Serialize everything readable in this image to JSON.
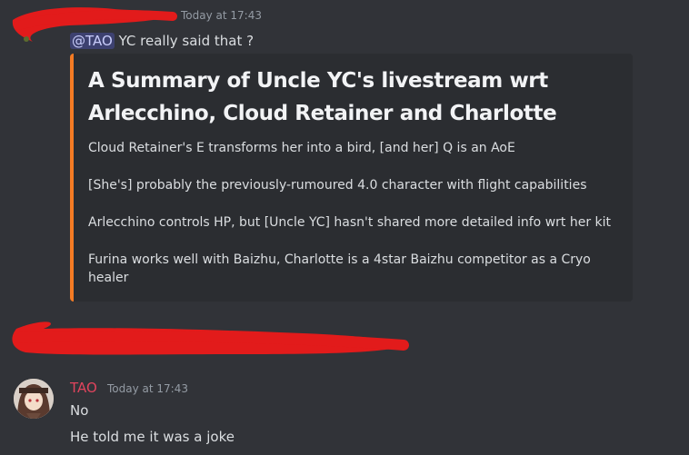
{
  "message1": {
    "timestamp": "Today at 17:43",
    "mention": "@TAO",
    "text": " YC really said that ?"
  },
  "embed": {
    "accent_color": "#f47b24",
    "title": "A Summary of Uncle YC's livestream wrt Arlecchino, Cloud Retainer and Charlotte",
    "lines": [
      "Cloud Retainer's E transforms her into a bird, [and her] Q is an AoE",
      "[She's] probably the previously-rumoured 4.0 character with flight capabilities",
      "Arlecchino controls HP, but [Uncle YC] hasn't shared more detailed info wrt her kit",
      "Furina works well with Baizhu, Charlotte is a 4star Baizhu competitor as a Cryo healer"
    ]
  },
  "message2": {
    "username": "TAO",
    "username_color": "#e0445d",
    "timestamp": "Today at 17:43",
    "lines": [
      "No",
      "He told me it was a joke"
    ]
  }
}
